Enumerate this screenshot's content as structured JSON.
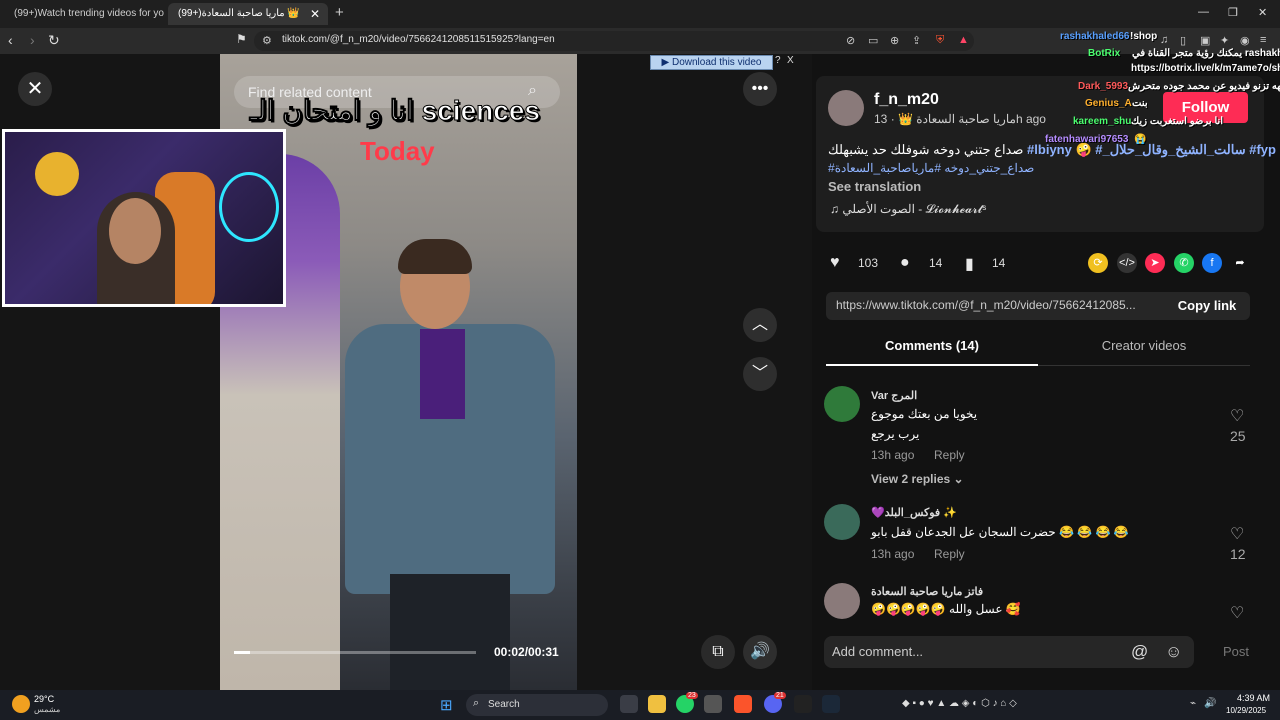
{
  "browser": {
    "tabs": [
      {
        "label": "(99+)Watch trending videos for you |"
      },
      {
        "label": "(99+)ماريا صاحبة السعادة 👑"
      }
    ],
    "new_tab": "+",
    "url": "tiktok.com/@f_n_m20/video/7566241208511515925?lang=en"
  },
  "video": {
    "search_placeholder": "Find related content",
    "caption_line1": "انا و امتحان الـ sciences",
    "caption_line2": "Today",
    "time": "00:02/00:31",
    "progress": 0.065,
    "download_label": "Download this video",
    "download_help": "?",
    "download_close": "X"
  },
  "post": {
    "username": "f_n_m20",
    "nickname": "ماريا صاحبة السعادة 👑 · 13h ago",
    "description_line1": "صداع جتني دوخه شوفلك حد يشبهلك",
    "description_tags": "#lbiyny 🤪 #_سالت_الشيخ_وقال_حلال #fyp",
    "description_line2": "#صداع_جتني_دوخه #مارياصاحبة_السعادة",
    "see_translation": "See translation",
    "music": "الصوت الأصلي - 𝓛𝓲𝓸𝓷𝓱𝓮𝓪𝓻𝓽ˢ",
    "follow": "Follow",
    "likes": "103",
    "comments": "14",
    "saves": "14",
    "link": "https://www.tiktok.com/@f_n_m20/video/75662412085...",
    "copy_link": "Copy link",
    "tab_comments": "Comments (14)",
    "tab_creator": "Creator videos"
  },
  "comments": [
    {
      "name": "Var المرج",
      "lines": [
        "يخويا من بعتك موجوع",
        "يرب يرجع"
      ],
      "meta": "13h ago",
      "reply": "Reply",
      "likes": "25",
      "view_replies": "View 2 replies ⌄"
    },
    {
      "name": "💜فوكس_البلد ✨",
      "lines": [
        "حضرت السجان عل الجدعان قفل بابو 😂 😂 😂 😂"
      ],
      "meta": "13h ago",
      "reply": "Reply",
      "likes": "12"
    },
    {
      "name": "فاتز ماريا صاحبة السعادة",
      "lines": [
        "🤪🤪🤪🤪🤪 عسل والله 🥰"
      ],
      "likes": ""
    }
  ],
  "add_comment": {
    "placeholder": "Add comment...",
    "post": "Post"
  },
  "chat": [
    {
      "user": "rashakhaled66",
      "text": "!shop",
      "color": "#59a0ff"
    },
    {
      "user": "",
      "text": "يمكنك رؤية متجر القناة في rashakhaled66",
      "color": "#ffffff"
    },
    {
      "user": "BotRix",
      "text": "",
      "color": "#4cff70"
    },
    {
      "user": "",
      "text": "https://botrix.live/k/m7ame7o/shop",
      "color": "#ffffff"
    },
    {
      "user": "",
      "text": "هههه تزنو فيديو عن محمد جوده متحرش 😂",
      "color": "#ffffff"
    },
    {
      "user": "Dark_5993",
      "text": "",
      "color": "#ff5a5a"
    },
    {
      "user": "Genius_A",
      "text": "بنت",
      "color": "#ffb02e"
    },
    {
      "user": "kareem_shu",
      "text": "انا برضو استغربت زيك",
      "color": "#4cff70"
    },
    {
      "user": "fatenhawari97653",
      "text": "😭",
      "color": "#b58cff"
    }
  ],
  "taskbar": {
    "temp": "29°C",
    "weather_desc": "مشمس",
    "search": "Search",
    "time": "4:39 AM",
    "date": "10/29/2025",
    "badge1": "23",
    "badge2": "21"
  },
  "colors": {
    "accent": "#fe2c55",
    "hashtag": "#8fb3ff"
  }
}
